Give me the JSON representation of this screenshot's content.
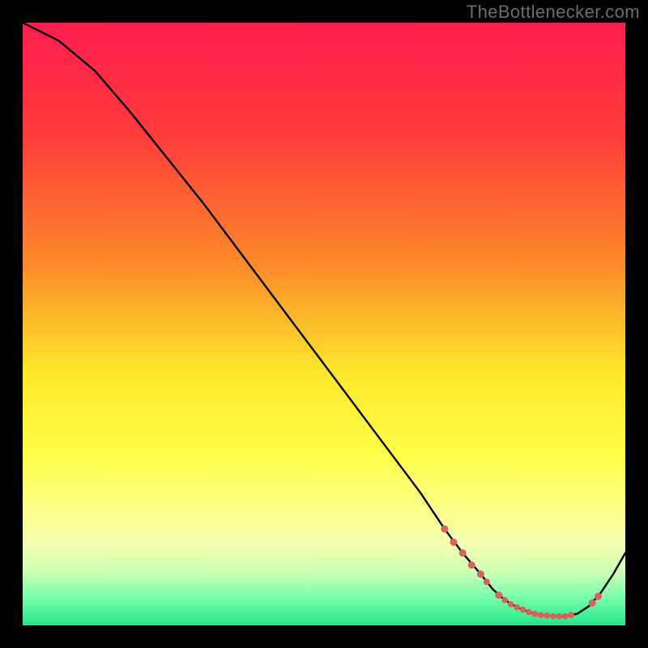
{
  "watermark": "TheBottlenecker.com",
  "chart_data": {
    "type": "line",
    "title": "",
    "xlabel": "",
    "ylabel": "",
    "xlim": [
      0,
      100
    ],
    "ylim": [
      0,
      100
    ],
    "background_gradient": {
      "stops": [
        {
          "offset": 0,
          "color": "#ff1d4f"
        },
        {
          "offset": 18,
          "color": "#ff3a3d"
        },
        {
          "offset": 40,
          "color": "#fc8a2a"
        },
        {
          "offset": 58,
          "color": "#fde72c"
        },
        {
          "offset": 72,
          "color": "#ffff4a"
        },
        {
          "offset": 86,
          "color": "#f6ffb0"
        },
        {
          "offset": 91,
          "color": "#d0ffb6"
        },
        {
          "offset": 95,
          "color": "#7dffad"
        },
        {
          "offset": 100,
          "color": "#24e78b"
        }
      ]
    },
    "series": [
      {
        "name": "bottleneck-curve",
        "x": [
          0,
          6,
          12,
          18,
          24,
          30,
          36,
          42,
          48,
          54,
          60,
          66,
          70,
          73,
          76,
          78,
          80,
          82,
          84,
          86,
          88,
          90,
          92,
          94,
          96,
          98,
          100
        ],
        "y": [
          100,
          97,
          92,
          85,
          77.5,
          70,
          62,
          54,
          46,
          38,
          30,
          22,
          16,
          12,
          8.5,
          6,
          4.2,
          3,
          2.2,
          1.7,
          1.5,
          1.5,
          1.9,
          3.2,
          5.5,
          8.5,
          12
        ]
      }
    ],
    "highlight_points": {
      "name": "highlight-dots",
      "color": "#d9635b",
      "points": [
        {
          "x": 70,
          "y": 16.0,
          "r": 4.5
        },
        {
          "x": 71.5,
          "y": 13.8,
          "r": 4.5
        },
        {
          "x": 73,
          "y": 12.0,
          "r": 4.5
        },
        {
          "x": 74.5,
          "y": 10.0,
          "r": 4.5
        },
        {
          "x": 76,
          "y": 8.5,
          "r": 4.5
        },
        {
          "x": 77,
          "y": 7.2,
          "r": 4.0
        },
        {
          "x": 79,
          "y": 5.0,
          "r": 4.5
        },
        {
          "x": 80,
          "y": 4.2,
          "r": 3.8
        },
        {
          "x": 81,
          "y": 3.5,
          "r": 3.8
        },
        {
          "x": 82,
          "y": 3.0,
          "r": 3.8
        },
        {
          "x": 83,
          "y": 2.6,
          "r": 3.8
        },
        {
          "x": 84,
          "y": 2.2,
          "r": 3.8
        },
        {
          "x": 85,
          "y": 1.9,
          "r": 3.8
        },
        {
          "x": 86,
          "y": 1.7,
          "r": 3.8
        },
        {
          "x": 87,
          "y": 1.6,
          "r": 3.8
        },
        {
          "x": 88,
          "y": 1.5,
          "r": 3.8
        },
        {
          "x": 89,
          "y": 1.5,
          "r": 3.8
        },
        {
          "x": 90,
          "y": 1.5,
          "r": 3.8
        },
        {
          "x": 91,
          "y": 1.7,
          "r": 3.8
        },
        {
          "x": 94.5,
          "y": 3.7,
          "r": 4.5
        },
        {
          "x": 95.5,
          "y": 4.8,
          "r": 4.5
        }
      ]
    }
  }
}
